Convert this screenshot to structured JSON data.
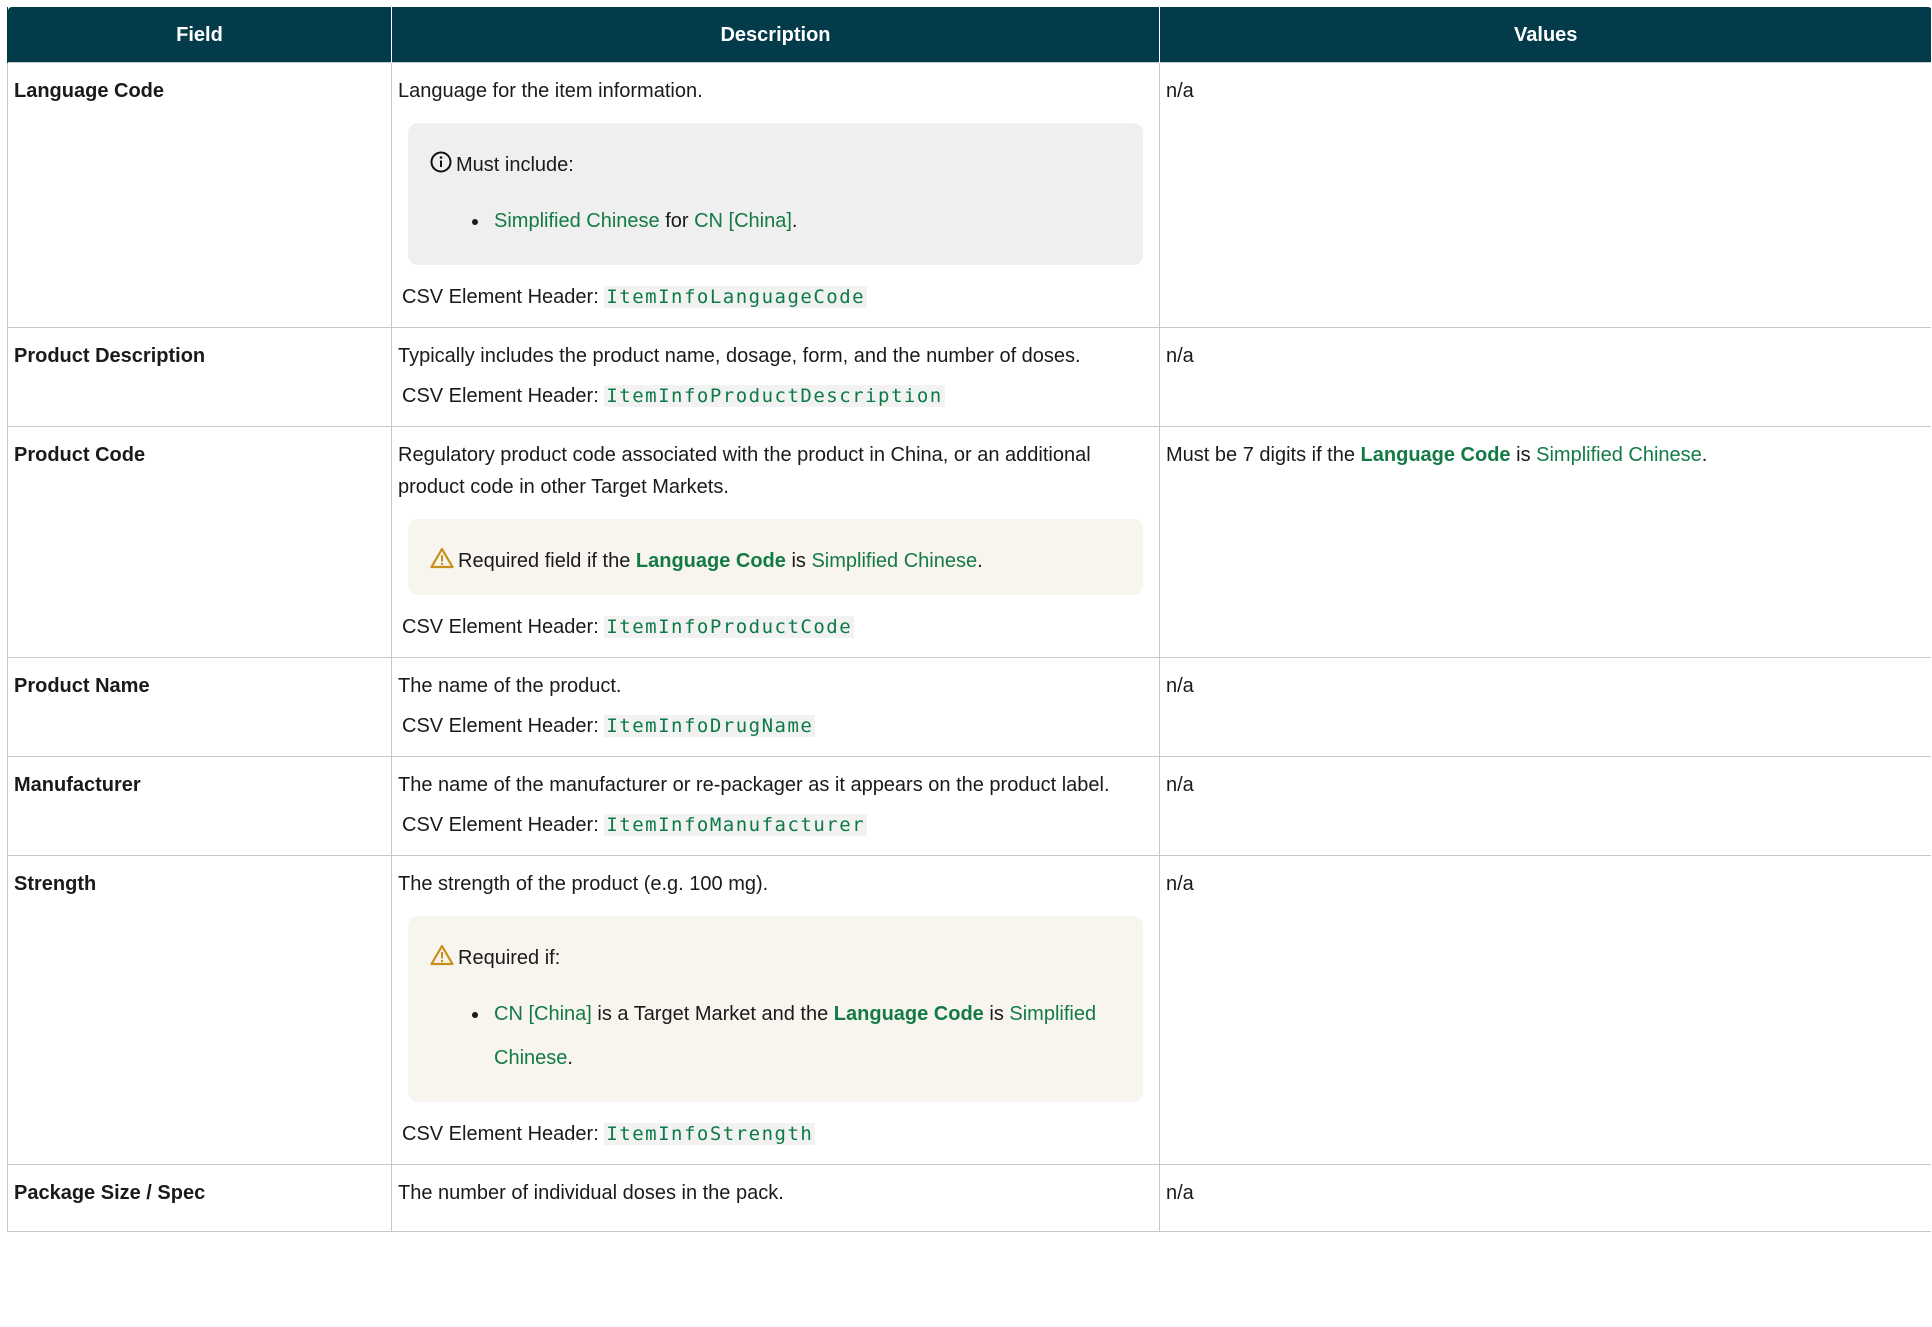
{
  "columns": {
    "field": "Field",
    "description": "Description",
    "values": "Values"
  },
  "csv_label": "CSV Element Header:",
  "rows": [
    {
      "field": "Language Code",
      "description": "Language for the item information.",
      "note": {
        "type": "info",
        "icon": "info-circle-icon",
        "heading": "Must include:",
        "bullet": {
          "link1": "Simplified Chinese",
          "mid": " for ",
          "link2": "CN [China]",
          "end": "."
        }
      },
      "csv_header": "ItemInfoLanguageCode",
      "value": "n/a"
    },
    {
      "field": "Product Description",
      "description": "Typically includes the product name, dosage, form, and the number of doses.",
      "csv_header": "ItemInfoProductDescription",
      "value": "n/a"
    },
    {
      "field": "Product Code",
      "description": "Regulatory product code associated with the product in China, or an additional product code in other Target Markets.",
      "note": {
        "type": "warning",
        "icon": "warning-triangle-icon",
        "pre": "Required field if the ",
        "bold_link": "Language Code",
        "mid": " is ",
        "link": "Simplified Chinese",
        "end": "."
      },
      "csv_header": "ItemInfoProductCode",
      "value": {
        "pre": "Must be 7 digits if the ",
        "bold_link": "Language Code",
        "mid": " is ",
        "link": "Simplified Chinese",
        "end": "."
      }
    },
    {
      "field": "Product Name",
      "description": "The name of the product.",
      "csv_header": "ItemInfoDrugName",
      "value": "n/a"
    },
    {
      "field": "Manufacturer",
      "description": "The name of the manufacturer or re-packager as it appears on the product label.",
      "csv_header": "ItemInfoManufacturer",
      "value": "n/a"
    },
    {
      "field": "Strength",
      "description": "The strength of the product (e.g. 100 mg).",
      "note": {
        "type": "warning",
        "icon": "warning-triangle-icon",
        "heading": "Required if:",
        "bullet": {
          "link1": "CN [China]",
          "mid": " is a Target Market and the ",
          "bold_link": "Language Code",
          "mid2": " is ",
          "link2": "Simplified Chinese",
          "end": "."
        }
      },
      "csv_header": "ItemInfoStrength",
      "value": "n/a"
    },
    {
      "field": "Package Size / Spec",
      "description": "The number of individual doses in the pack.",
      "value": "n/a"
    }
  ],
  "colors": {
    "header_bg": "#033b4a",
    "link": "#137a45",
    "code": "#0b7a45",
    "info_bg": "#efefef",
    "warn_bg": "#f8f5ef",
    "warn_icon": "#c8901a"
  }
}
